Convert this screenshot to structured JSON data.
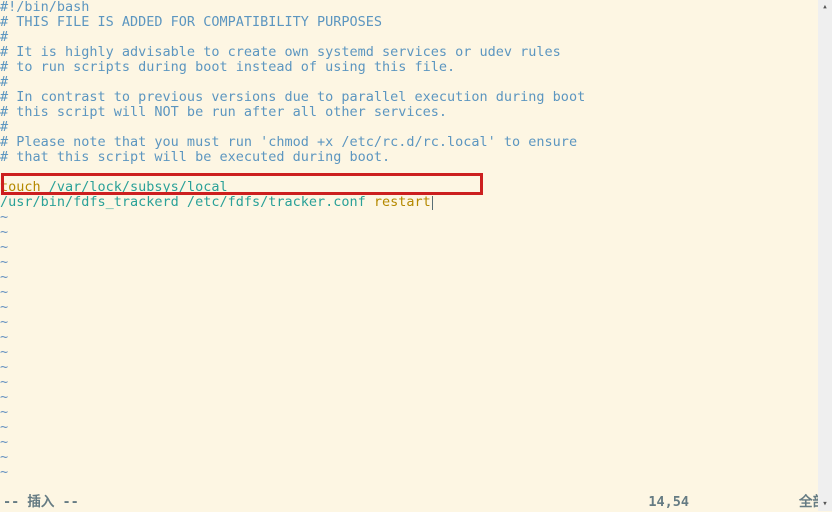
{
  "editor": {
    "lines": [
      {
        "type": "comment",
        "text": "#!/bin/bash"
      },
      {
        "type": "comment",
        "text": "# THIS FILE IS ADDED FOR COMPATIBILITY PURPOSES"
      },
      {
        "type": "comment",
        "text": "#"
      },
      {
        "type": "comment",
        "text": "# It is highly advisable to create own systemd services or udev rules"
      },
      {
        "type": "comment",
        "text": "# to run scripts during boot instead of using this file."
      },
      {
        "type": "comment",
        "text": "#"
      },
      {
        "type": "comment",
        "text": "# In contrast to previous versions due to parallel execution during boot"
      },
      {
        "type": "comment",
        "text": "# this script will NOT be run after all other services."
      },
      {
        "type": "comment",
        "text": "#"
      },
      {
        "type": "comment",
        "text": "# Please note that you must run 'chmod +x /etc/rc.d/rc.local' to ensure"
      },
      {
        "type": "comment",
        "text": "# that this script will be executed during boot."
      },
      {
        "type": "blank",
        "text": ""
      },
      {
        "type": "cmd1",
        "kw": "touch",
        "path": " /var/lock/subsys/local"
      },
      {
        "type": "cmd2",
        "path": "/usr/bin/fdfs_trackerd /etc/fdfs/tracker.conf ",
        "kw": "restart",
        "cursor": true
      }
    ],
    "tilde_count": 18,
    "tilde_char": "~"
  },
  "highlight": {
    "target_line_index": 13
  },
  "status": {
    "mode": "-- 插入 --",
    "position": "14,54",
    "percent": "全部"
  },
  "scrollbar": {
    "up_glyph": "▴",
    "down_glyph": "▾"
  }
}
